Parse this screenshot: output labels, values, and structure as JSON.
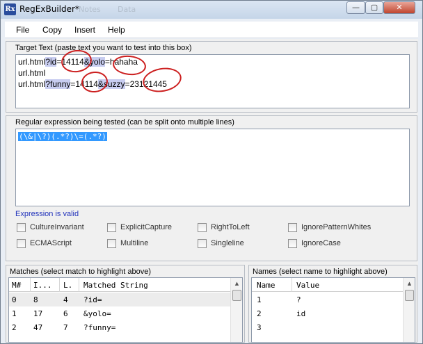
{
  "window": {
    "title": "RegExBuilder*",
    "icon_text": "Rx",
    "ghost_tabs": [
      "Notes",
      "Data"
    ],
    "controls": {
      "minimize": "—",
      "maximize": "▢",
      "close": "✕"
    }
  },
  "menu": {
    "items": [
      "File",
      "Copy",
      "Insert",
      "Help"
    ]
  },
  "target": {
    "label": "Target Text (paste text you want to test into this box)",
    "lines": [
      {
        "a": "url.html",
        "b": "?id",
        "c": "=14114",
        "d": "&yolo",
        "e": "=hahaha"
      },
      {
        "a": "url.html"
      },
      {
        "a": "url.html",
        "b": "?funny",
        "c": "=14114",
        "d": "&suzzy",
        "e": "=23121445"
      }
    ]
  },
  "regex": {
    "label": "Regular expression being tested (can be split onto multiple lines)",
    "value": "(\\&|\\?)(.*?)\\=(.*?)",
    "status": "Expression is valid"
  },
  "options": [
    {
      "label": "CultureInvariant",
      "checked": false
    },
    {
      "label": "ExplicitCapture",
      "checked": false
    },
    {
      "label": "RightToLeft",
      "checked": false
    },
    {
      "label": "IgnorePatternWhites",
      "checked": false
    },
    {
      "label": "ECMAScript",
      "checked": false
    },
    {
      "label": "Multiline",
      "checked": false
    },
    {
      "label": "Singleline",
      "checked": false
    },
    {
      "label": "IgnoreCase",
      "checked": false
    }
  ],
  "matches": {
    "label": "Matches (select match to highlight above)",
    "columns": [
      "M#",
      "I...",
      "L.",
      "Matched String"
    ],
    "rows": [
      [
        "0",
        "8",
        "4",
        "?id="
      ],
      [
        "1",
        "17",
        "6",
        "&yolo="
      ],
      [
        "2",
        "47",
        "7",
        "?funny="
      ]
    ]
  },
  "names": {
    "label": "Names (select name to highlight above)",
    "columns": [
      "Name",
      "Value"
    ],
    "rows": [
      [
        "1",
        "?"
      ],
      [
        "2",
        "id"
      ],
      [
        "3",
        ""
      ]
    ]
  },
  "colors": {
    "selection": "#3399ff",
    "highlight": "#c8cdf0",
    "annotation": "#cc1f1f",
    "valid_text": "#2233bb"
  }
}
